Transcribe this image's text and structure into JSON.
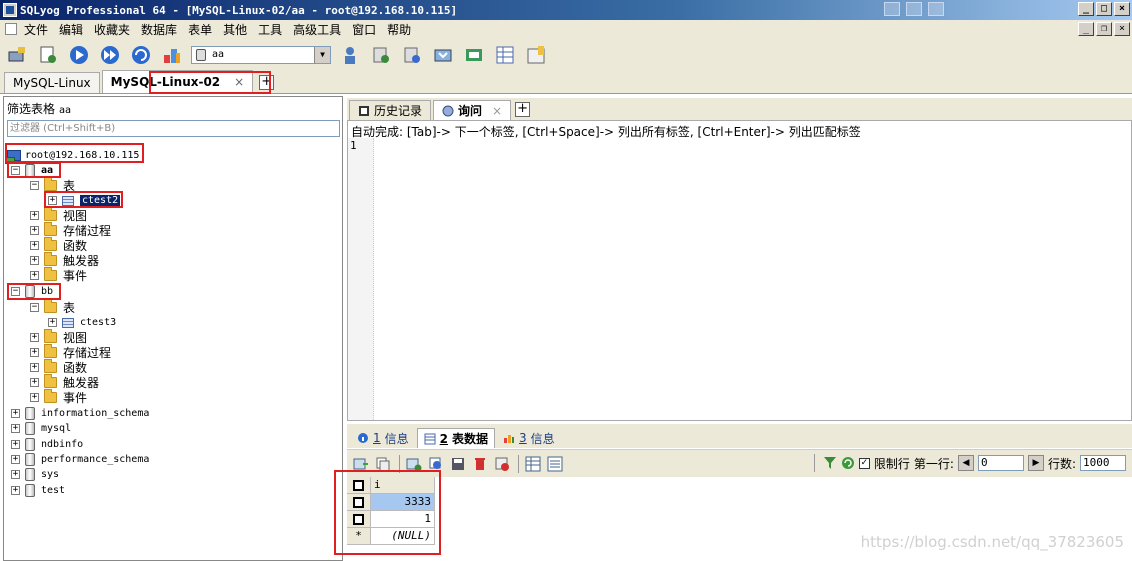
{
  "window": {
    "title": "SQLyog Professional 64 - [MySQL-Linux-02/aa - root@192.168.10.115]",
    "controls": [
      "_",
      "□",
      "×"
    ],
    "mdi_controls": [
      "_",
      "❐",
      "×"
    ]
  },
  "menu": [
    "文件",
    "编辑",
    "收藏夹",
    "数据库",
    "表单",
    "其他",
    "工具",
    "高级工具",
    "窗口",
    "帮助"
  ],
  "toolbar": {
    "database_select": "aa"
  },
  "connection_tabs": [
    {
      "label": "MySQL-Linux"
    },
    {
      "label": "MySQL-Linux-02",
      "active": true,
      "close": "×"
    }
  ],
  "object_browser": {
    "filter_label": "筛选表格",
    "filter_db": "aa",
    "filter_placeholder": "过滤器 (Ctrl+Shift+B)",
    "connection": "root@192.168.10.115",
    "db_aa": "aa",
    "aa_tables": "表",
    "aa_table1": "ctest2",
    "aa_views": "视图",
    "aa_procs": "存储过程",
    "aa_funcs": "函数",
    "aa_triggers": "触发器",
    "aa_events": "事件",
    "db_bb": "bb",
    "bb_tables": "表",
    "bb_table1": "ctest3",
    "bb_views": "视图",
    "bb_procs": "存储过程",
    "bb_funcs": "函数",
    "bb_triggers": "触发器",
    "bb_events": "事件",
    "db_info_schema": "information_schema",
    "db_mysql": "mysql",
    "db_ndbinfo": "ndbinfo",
    "db_perf_schema": "performance_schema",
    "db_sys": "sys",
    "db_test": "test"
  },
  "query_tabs": {
    "history": "历史记录",
    "query": "询问",
    "close": "×"
  },
  "editor": {
    "hint": "自动完成: [Tab]-> 下一个标签, [Ctrl+Space]-> 列出所有标签, [Ctrl+Enter]-> 列出匹配标签",
    "line_number": "1"
  },
  "result_tabs": {
    "t1_num": "1",
    "t1_label": "信息",
    "t2_num": "2",
    "t2_label": "表数据",
    "t3_num": "3",
    "t3_label": "信息"
  },
  "result_toolbar": {
    "limit_label": "限制行",
    "first_row_label": "第一行:",
    "first_row_value": "0",
    "rows_label": "行数:",
    "rows_value": "1000"
  },
  "grid": {
    "column": "i",
    "rows": [
      "3333",
      "1"
    ],
    "new_row_marker": "*",
    "null_text": "(NULL)"
  },
  "watermark": "https://blog.csdn.net/qq_37823605",
  "colors": {
    "highlight": "#e02020",
    "selection": "#0a246a"
  }
}
